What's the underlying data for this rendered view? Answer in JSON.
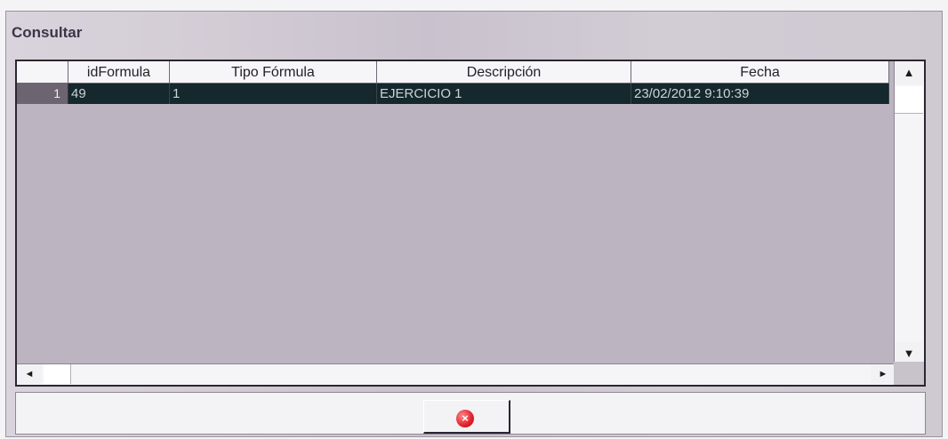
{
  "window": {
    "title": "Consultar"
  },
  "grid": {
    "columns": [
      "idFormula",
      "Tipo Fórmula",
      "Descripción",
      "Fecha"
    ],
    "rows": [
      {
        "row_number": "1",
        "cells": [
          "49",
          "1",
          "EJERCICIO 1",
          "23/02/2012 9:10:39"
        ]
      }
    ]
  },
  "scrollbars": {
    "up_arrow": "▲",
    "down_arrow": "▼",
    "left_arrow": "◄",
    "right_arrow": "►"
  },
  "close_button": {
    "icon": "close-icon",
    "glyph": "×",
    "color": "#e0202a"
  },
  "colors": {
    "selected_row_bg": "#14282d",
    "header_bg": "#f6f6f8"
  }
}
